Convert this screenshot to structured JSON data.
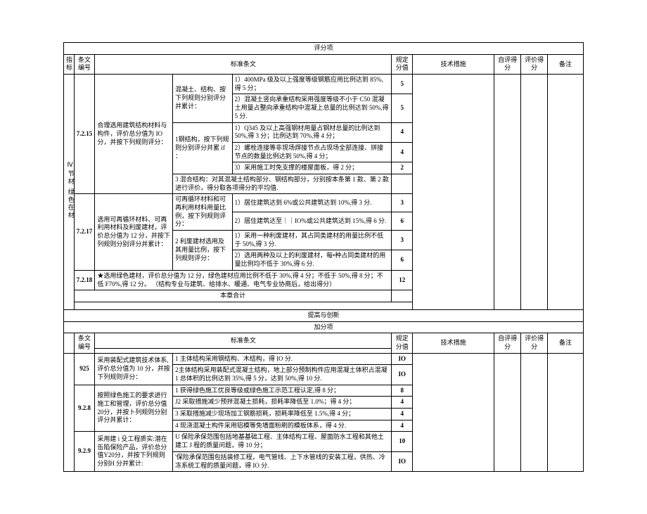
{
  "section1": {
    "header_row_title": "评分项",
    "cols": {
      "indicator": "指标",
      "clause_no": "条文编号",
      "standard": "标准条文",
      "spec_value": "规定分值",
      "tech_measure": "技术措施",
      "self_score": "自评得分",
      "eval_score": "评价得分",
      "remark": "备注"
    },
    "side_label_top": "Ⅳ节材",
    "side_label_bot": "绿色在材",
    "r7215": {
      "no": "7.2.15",
      "desc": "合理选用建筑结构材料与构件，评价总分值为 IO 分，并按下列规则评分：",
      "a_head": "混凝土、结构、按下列规则分别评分并累计：",
      "a1": "1）400MPa 级及以上强度等级钢筋应用比例达到 85%,得 5 分；",
      "a1v": "5",
      "a2": "2）混凝土竖向承重结构采用强度等级不小于 C50 混凝土用量占整向承重结构中混凝上总量的比例达到 50%,得 5 分.",
      "a2v": "5",
      "b_head": "1钢结构，按下列规则分别评分并累 if ：",
      "b1": "1）Q345 及以上高强钢材用量占钢材总量的比例达到 50%,得 3 分；比例达到 70%,得 4 分；",
      "b1v": "4",
      "b2": "2）螺栓连接等非现场焊接节点占现场全部连接、拼接节点的数量比例达到 50%,得 4 分；",
      "b2v": "4",
      "b3": "3）采用施工时免支撑的楼屋面板，得 2 分；",
      "b3v": "2",
      "c": "3 混合结构：对其混凝土结构部分、钢结构部分，分别按本条第 1 款、第 2 款进行评价，得分取各项得分的平均值."
    },
    "r7217": {
      "no": "7.2.17",
      "desc": "选用可再循环材料、可再利用材料及利废建材，评价总分值为 12 分，并按下列规则分别评分并累计：",
      "a_head": "可再循环材料和可再利用材料用量比例，按下列规则评分：",
      "a1": "1）居住建筑达到 6%或公共建筑达到 10%,得 3 分.",
      "a1v": "3",
      "a2": "2）居住建筑达至｜｜IO%或公共建筑达到 15%,得 6 分.",
      "a2v": "6",
      "b_head": "2 利废建材选用及其用量比例，按下列规则评分：",
      "b1": "1）采用一种利废建材，其占同类建材的用量比例不低于 50%,得 3 分.",
      "b1v": "3",
      "b2": "2）选用两种及以上的利废建材，每•种占同类建材的用量比例均不低于 30%,得 6 分.",
      "b2v": "6"
    },
    "r7218": {
      "no": "7.2.18",
      "text": "★选用绿色建材，评价总分值为 12 分，绿色建材应用比例不低于 30%,得 4 分；不低于 50%,得 8 分；不低 F70%,得 12 分。 （结构专业与建筑、给排水、暖通、电气专业协商后，给出得分）",
      "v": "12"
    },
    "subtotal": "本章合计"
  },
  "section2": {
    "title": "提高与创新",
    "sub": "加分项",
    "cols": {
      "clause_no": "条文编号",
      "standard": "标准条文",
      "spec_value": "规定分值",
      "tech_measure": "技术措施",
      "self_score": "自评得分",
      "eval_score": "评价得分",
      "remark": "备注"
    },
    "r925": {
      "no": "925",
      "desc": "采用装配式建筑技术体系, 评价总分值为 10 分，并按下列规则评分：",
      "r1": "1 主体结构采用钢结构、木结构，得 IO 分.",
      "r1v": "IO",
      "r2": "2主体结构采用装配式混凝土结构，地上部分预制构件应用混凝土体积占混凝 1 总体积的比例达到 35%,得 5 分，达到 50%,得 10 分.",
      "r2v": "IO"
    },
    "r928": {
      "no": "9.2.8",
      "desc": "按照绿色施工的要求进行施工和管理，评价总分值20分，并按卜列规则分别评分并累计：",
      "r1": "1 获得绿色施工优良等级或绿色施工示范工程认定,得 8 分；",
      "r1v": "8",
      "r2": "J2 采取措施减少预拌混凝土损耗，损耗率降低至 1.0%；得 4 分；",
      "r2v": "4",
      "r3": "3 采取措施减少现场加工钢筋损耗，损耗率降低至 1.5%,得 4 分；",
      "r3v": "4",
      "r4": "4 现浇混凝土构件采用铝模等免墙面粉刷的模板体系，得 4 分.",
      "r4v": "4"
    },
    "r929": {
      "no": "9.2.9",
      "desc": "采用建 i 殳工程质实:潜在缶陷保险产品，评价总分值Y20分，并按下列规则分别H 分并累计:",
      "r1": "U 保险承保范围包括地基基础工程、主体结构工程、屋面防水工程和其他土建工 J 程的质量问题，得 10 分；",
      "r1v": "10",
      "r2": "'保险承保范围包括装修工程，电气管线、上下水管线的安装工程，供热、冷冻系统工程的质量问题，得 IO 分.",
      "r2v": "IO"
    }
  }
}
